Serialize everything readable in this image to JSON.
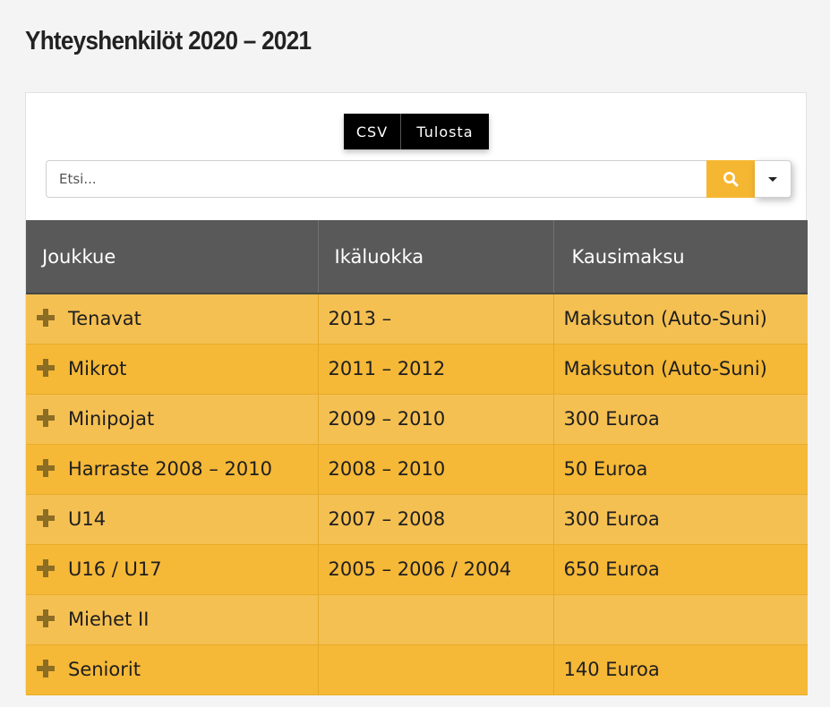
{
  "page": {
    "title": "Yhteyshenkilöt 2020 – 2021"
  },
  "toolbar": {
    "csv_label": "CSV",
    "print_label": "Tulosta"
  },
  "search": {
    "placeholder": "Etsi...",
    "value": ""
  },
  "colors": {
    "accent": "#f5b731",
    "header_bg": "#595959",
    "row_odd": "#f5c052",
    "row_even": "#f5b837",
    "expand_icon": "#8b6d23"
  },
  "icons": {
    "search": "search-icon",
    "dropdown": "caret-down-icon",
    "expand": "plus-icon"
  },
  "table": {
    "columns": [
      "Joukkue",
      "Ikäluokka",
      "Kausimaksu"
    ],
    "rows": [
      [
        "Tenavat",
        "2013 –",
        "Maksuton (Auto-Suni)"
      ],
      [
        "Mikrot",
        "2011 – 2012",
        "Maksuton (Auto-Suni)"
      ],
      [
        "Minipojat",
        "2009 – 2010",
        "300 Euroa"
      ],
      [
        "Harraste 2008 – 2010",
        "2008 – 2010",
        "50 Euroa"
      ],
      [
        "U14",
        "2007 – 2008",
        "300 Euroa"
      ],
      [
        "U16 / U17",
        "2005 – 2006 / 2004",
        "650 Euroa"
      ],
      [
        "Miehet II",
        "",
        ""
      ],
      [
        "Seniorit",
        "",
        "140 Euroa"
      ]
    ]
  }
}
